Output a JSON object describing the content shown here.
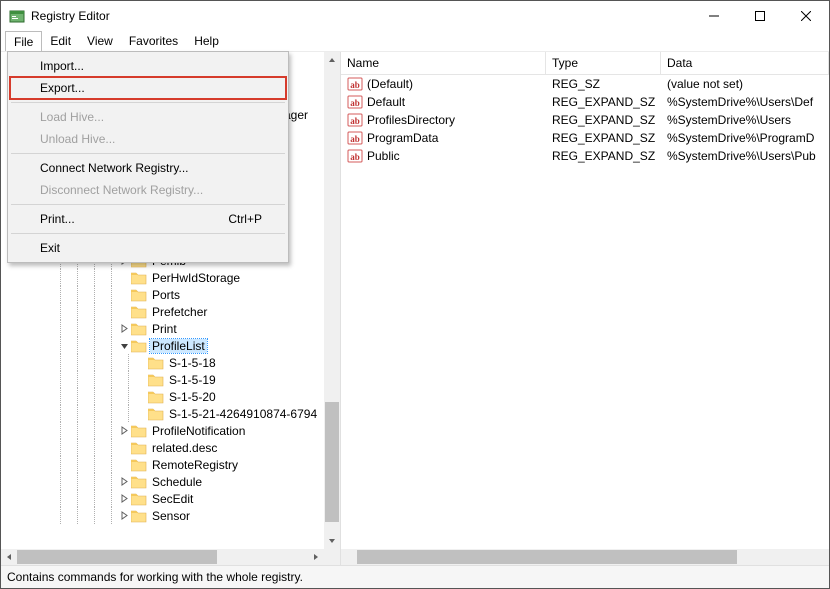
{
  "window": {
    "title": "Registry Editor"
  },
  "menubar": [
    "File",
    "Edit",
    "View",
    "Favorites",
    "Help"
  ],
  "file_menu": {
    "import": "Import...",
    "export": "Export...",
    "load_hive": "Load Hive...",
    "unload_hive": "Unload Hive...",
    "connect": "Connect Network Registry...",
    "disconnect": "Disconnect Network Registry...",
    "print": "Print...",
    "print_shortcut": "Ctrl+P",
    "exit": "Exit"
  },
  "tree_peek": "ager",
  "tree": [
    {
      "depth": 7,
      "expander": ">",
      "label": "Pemib"
    },
    {
      "depth": 7,
      "expander": "",
      "label": "PerHwIdStorage"
    },
    {
      "depth": 7,
      "expander": "",
      "label": "Ports"
    },
    {
      "depth": 7,
      "expander": "",
      "label": "Prefetcher"
    },
    {
      "depth": 7,
      "expander": ">",
      "label": "Print"
    },
    {
      "depth": 7,
      "expander": "v",
      "label": "ProfileList",
      "selected": true
    },
    {
      "depth": 8,
      "expander": "",
      "label": "S-1-5-18"
    },
    {
      "depth": 8,
      "expander": "",
      "label": "S-1-5-19"
    },
    {
      "depth": 8,
      "expander": "",
      "label": "S-1-5-20"
    },
    {
      "depth": 8,
      "expander": "",
      "label": "S-1-5-21-4264910874-6794"
    },
    {
      "depth": 7,
      "expander": ">",
      "label": "ProfileNotification"
    },
    {
      "depth": 7,
      "expander": "",
      "label": "related.desc"
    },
    {
      "depth": 7,
      "expander": "",
      "label": "RemoteRegistry"
    },
    {
      "depth": 7,
      "expander": ">",
      "label": "Schedule"
    },
    {
      "depth": 7,
      "expander": ">",
      "label": "SecEdit"
    },
    {
      "depth": 7,
      "expander": ">",
      "label": "Sensor"
    }
  ],
  "columns": {
    "name": "Name",
    "type": "Type",
    "data": "Data"
  },
  "values": [
    {
      "name": "(Default)",
      "type": "REG_SZ",
      "data": "(value not set)"
    },
    {
      "name": "Default",
      "type": "REG_EXPAND_SZ",
      "data": "%SystemDrive%\\Users\\Def"
    },
    {
      "name": "ProfilesDirectory",
      "type": "REG_EXPAND_SZ",
      "data": "%SystemDrive%\\Users"
    },
    {
      "name": "ProgramData",
      "type": "REG_EXPAND_SZ",
      "data": "%SystemDrive%\\ProgramD"
    },
    {
      "name": "Public",
      "type": "REG_EXPAND_SZ",
      "data": "%SystemDrive%\\Users\\Pub"
    }
  ],
  "statusbar": "Contains commands for working with the whole registry."
}
